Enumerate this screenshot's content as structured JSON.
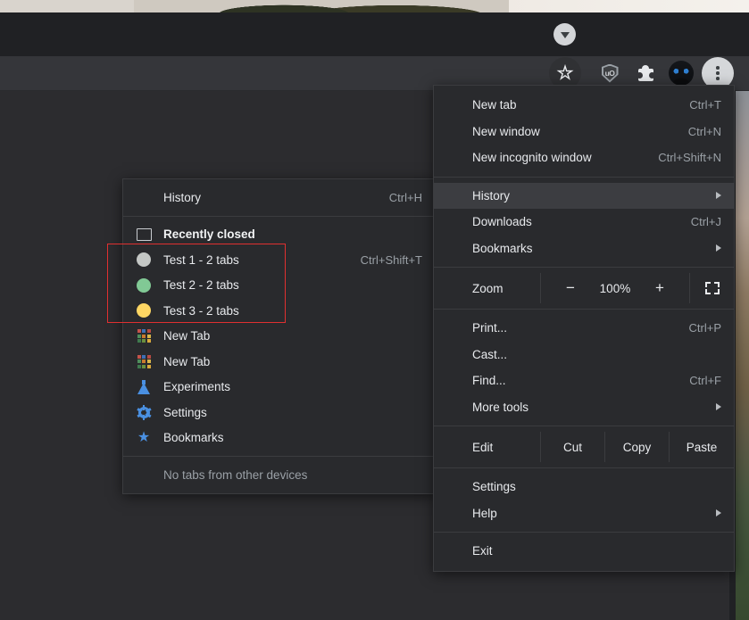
{
  "page": {
    "background_color": "#2c2c2f",
    "content_strip_color": "#d9d4cd"
  },
  "toolbar": {
    "scroll_chevron_icon": "chevron-down-circle-icon",
    "bookmark_icon": "star-outline-icon",
    "extension_shield_label": "uO",
    "extension_shield_icon": "shield-icon",
    "extensions_icon": "puzzle-piece-icon",
    "profile_icon": "avatar-icon",
    "menu_icon": "three-dot-menu-icon"
  },
  "main_menu": {
    "groups": [
      {
        "items": [
          {
            "label": "New tab",
            "accel": "Ctrl+T",
            "name": "new-tab"
          },
          {
            "label": "New window",
            "accel": "Ctrl+N",
            "name": "new-window"
          },
          {
            "label": "New incognito window",
            "accel": "Ctrl+Shift+N",
            "name": "new-incognito-window"
          }
        ]
      },
      {
        "items": [
          {
            "label": "History",
            "accel": "",
            "name": "history",
            "submenu": true,
            "highlighted": true
          },
          {
            "label": "Downloads",
            "accel": "Ctrl+J",
            "name": "downloads"
          },
          {
            "label": "Bookmarks",
            "accel": "",
            "name": "bookmarks",
            "submenu": true
          }
        ]
      }
    ],
    "zoom_row": {
      "label": "Zoom",
      "minus": "−",
      "percent": "100%",
      "plus": "+",
      "fullscreen_icon": "fullscreen-icon"
    },
    "tools_group": [
      {
        "label": "Print...",
        "accel": "Ctrl+P",
        "name": "print"
      },
      {
        "label": "Cast...",
        "accel": "",
        "name": "cast"
      },
      {
        "label": "Find...",
        "accel": "Ctrl+F",
        "name": "find"
      },
      {
        "label": "More tools",
        "accel": "",
        "name": "more-tools",
        "submenu": true
      }
    ],
    "edit_row": {
      "label": "Edit",
      "cut": "Cut",
      "copy": "Copy",
      "paste": "Paste"
    },
    "settings_group": [
      {
        "label": "Settings",
        "accel": "",
        "name": "settings"
      },
      {
        "label": "Help",
        "accel": "",
        "name": "help",
        "submenu": true
      }
    ],
    "exit_group": [
      {
        "label": "Exit",
        "accel": "",
        "name": "exit"
      }
    ]
  },
  "history_submenu": {
    "header": {
      "label": "History",
      "accel": "Ctrl+H"
    },
    "recently_closed": {
      "label": "Recently closed",
      "icon": "window-restore-icon"
    },
    "sessions": [
      {
        "label": "Test 1 - 2 tabs",
        "accel": "Ctrl+Shift+T",
        "color": "#c4c7c5",
        "icon": "circle-icon"
      },
      {
        "label": "Test 2 - 2 tabs",
        "accel": "",
        "color": "#81c995",
        "icon": "circle-icon"
      },
      {
        "label": "Test 3 - 2 tabs",
        "accel": "",
        "color": "#fdd663",
        "icon": "circle-icon"
      }
    ],
    "tabs": [
      {
        "label": "New Tab",
        "icon": "new-tab-grid-favicon"
      },
      {
        "label": "New Tab",
        "icon": "new-tab-grid-favicon"
      }
    ],
    "pages": [
      {
        "label": "Experiments",
        "icon": "flask-icon"
      },
      {
        "label": "Settings",
        "icon": "gear-icon"
      },
      {
        "label": "Bookmarks",
        "icon": "star-icon"
      }
    ],
    "footer": {
      "label": "No tabs from other devices"
    }
  },
  "annotation": {
    "color": "#e03030",
    "name": "red-highlight-box"
  },
  "favicon_grid_colors": [
    "#c5534a",
    "#3e6fb5",
    "#b84a42",
    "#4f8f5c",
    "#c97a2e",
    "#d8b54a",
    "#3f7a4e",
    "#6a8f3e",
    "#d9a93c"
  ]
}
